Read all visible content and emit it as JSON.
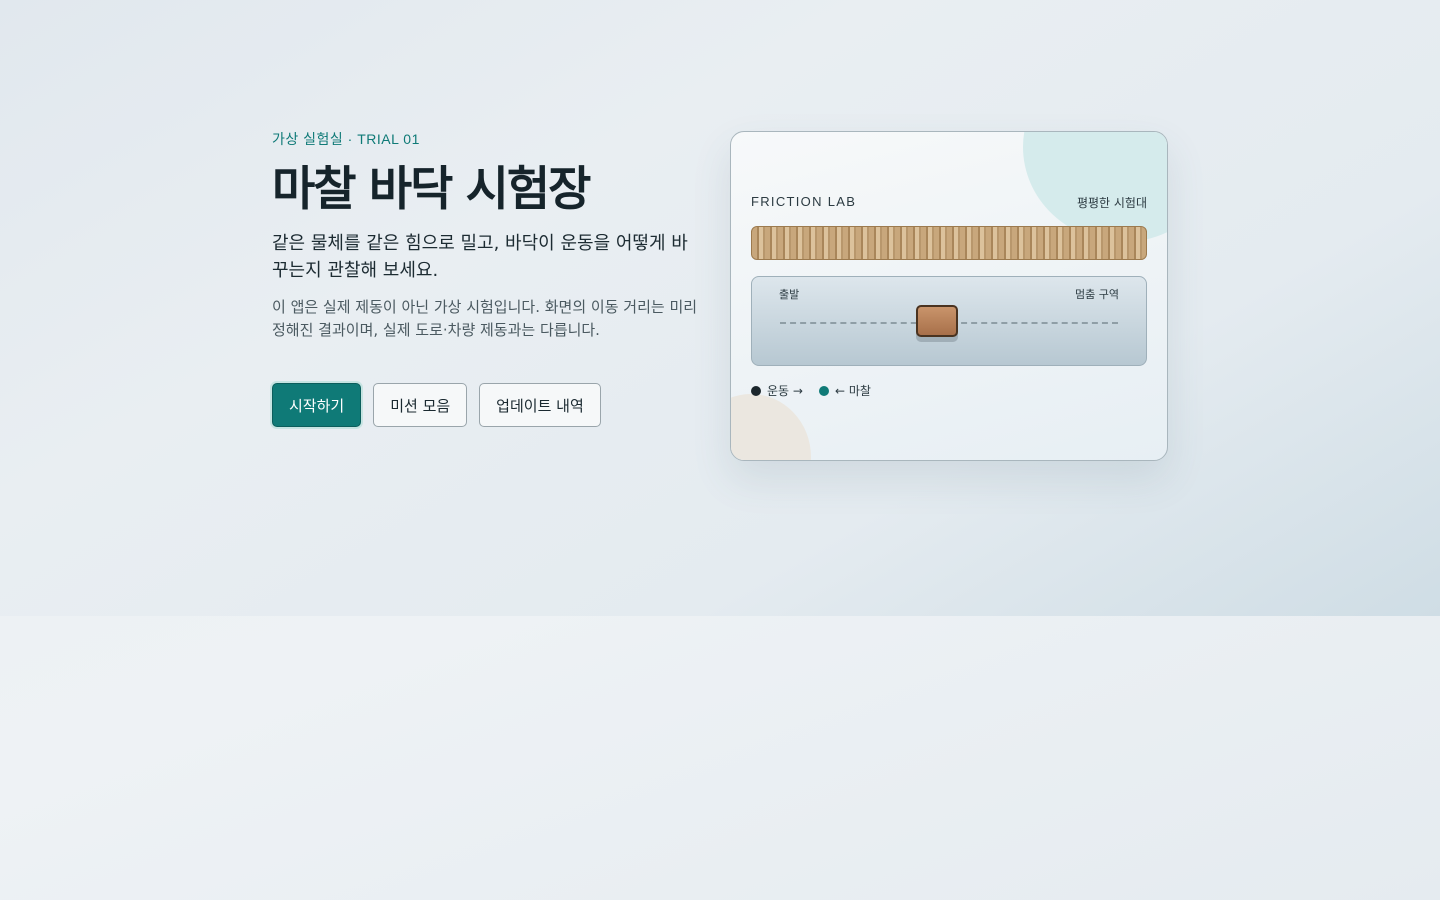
{
  "hero": {
    "eyebrow": "가상 실험실 · TRIAL 01",
    "title": "마찰 바닥 시험장",
    "lead": "같은 물체를 같은 힘으로 밀고, 바닥이 운동을 어떻게 바꾸는지 관찰해 보세요.",
    "note": "이 앱은 실제 제동이 아닌 가상 시험입니다. 화면의 이동 거리는 미리 정해진 결과이며, 실제 도로·차량 제동과는 다릅니다."
  },
  "buttons": {
    "start": "시작하기",
    "missions": "미션 모음",
    "updates": "업데이트 내역"
  },
  "card": {
    "label": "FRICTION LAB",
    "badge": "평평한 시험대",
    "track_start": "출발",
    "track_stop": "멈춤 구역",
    "legend": {
      "motion": "운동 →",
      "friction": "← 마찰"
    }
  },
  "colors": {
    "accent": "#0f7a77",
    "motion_dot": "#1b262c",
    "friction_dot": "#0f7a77"
  }
}
